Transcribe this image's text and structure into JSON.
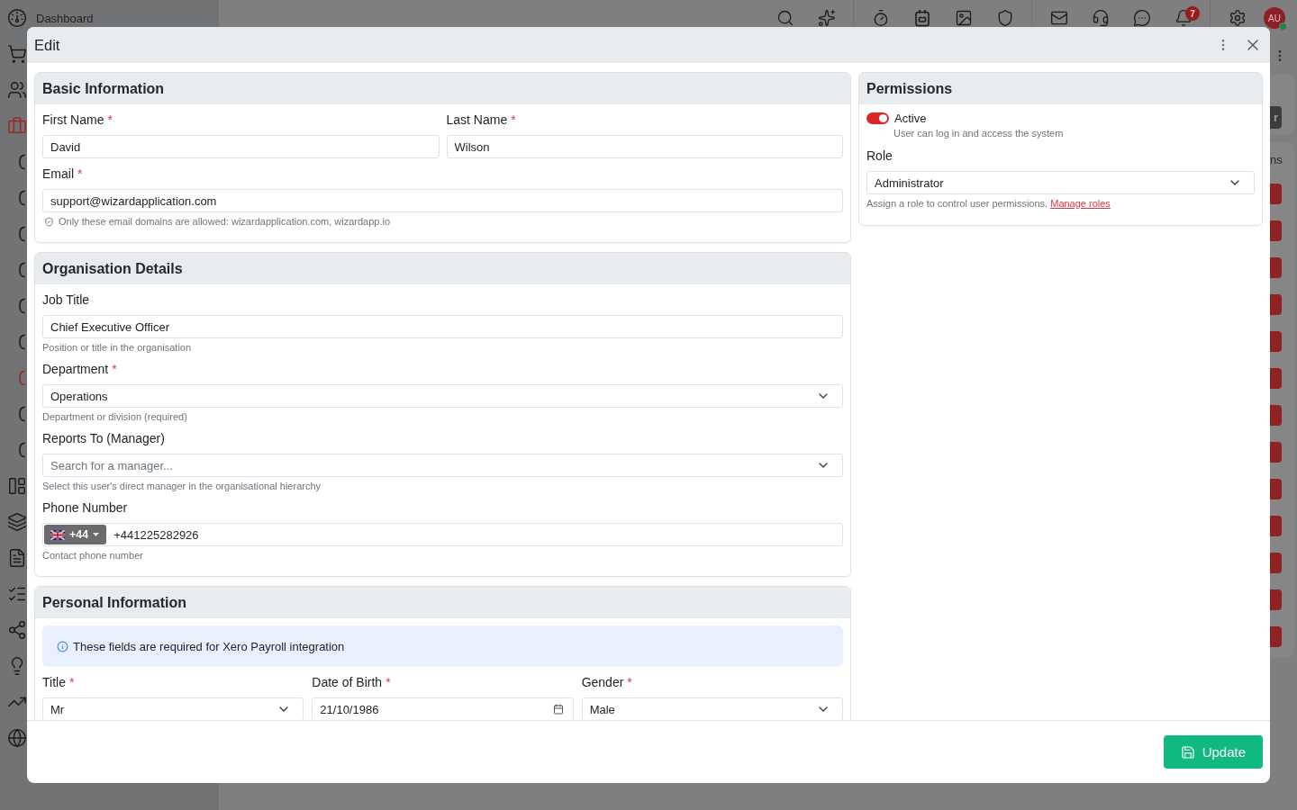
{
  "sidebar": {
    "items": [
      {
        "label": "Dashboard",
        "selected": false
      },
      {
        "selected": false
      },
      {
        "selected": false
      },
      {
        "selected": true,
        "children": [
          {
            "selected": false
          },
          {
            "selected": false
          },
          {
            "selected": false
          },
          {
            "selected": false
          },
          {
            "selected": false
          },
          {
            "selected": false
          },
          {
            "selected": true
          },
          {
            "selected": false
          },
          {
            "selected": false
          }
        ]
      },
      {
        "selected": false
      },
      {
        "selected": false
      },
      {
        "selected": false
      },
      {
        "selected": false
      },
      {
        "selected": false
      },
      {
        "selected": false
      },
      {
        "selected": false
      },
      {
        "selected": false
      }
    ]
  },
  "top_bar": {
    "notification_count": "7",
    "avatar": {
      "initials": "AU",
      "online": true
    }
  },
  "back_panel": {
    "button": "r",
    "heading": "ns"
  },
  "dialog": {
    "title": "Edit",
    "sections": [
      {
        "title": "Basic Information",
        "rows": [
          [
            {
              "kind": "text",
              "label": "First Name",
              "required_mark": "*",
              "value": "David"
            },
            {
              "kind": "text",
              "label": "Last Name",
              "required_mark": "*",
              "value": "Wilson"
            }
          ],
          [
            {
              "kind": "text",
              "label": "Email",
              "required_mark": "*",
              "value": "support@wizardapplication.com",
              "hint": "Only these email domains are allowed: wizardapplication.com, wizardapp.io",
              "hint_icon": true
            }
          ]
        ]
      },
      {
        "title": "Organisation Details",
        "rows": [
          [
            {
              "kind": "text",
              "label": "Job Title",
              "value": "Chief Executive Officer",
              "hint": "Position or title in the organisation"
            }
          ],
          [
            {
              "kind": "select",
              "label": "Department",
              "required_mark": "*",
              "value": "Operations",
              "hint": "Department or division (required)"
            }
          ],
          [
            {
              "kind": "select",
              "label": "Reports To (Manager)",
              "placeholder": "Search for a manager...",
              "hint": "Select this user's direct manager in the organisational hierarchy"
            }
          ],
          [
            {
              "kind": "phone",
              "label": "Phone Number",
              "country_code": "+44",
              "value": "+441225282926",
              "hint": "Contact phone number"
            }
          ]
        ]
      },
      {
        "title": "Personal Information",
        "rows": [
          [
            {
              "kind": "notice",
              "text": "These fields are required for Xero Payroll integration"
            }
          ],
          [
            {
              "kind": "select",
              "label": "Title",
              "required_mark": "*",
              "value": "Mr"
            },
            {
              "kind": "date",
              "label": "Date of Birth",
              "required_mark": "*",
              "value": "21/10/1986"
            },
            {
              "kind": "select",
              "label": "Gender",
              "required_mark": "*",
              "value": "Male"
            }
          ]
        ]
      }
    ],
    "permissions": {
      "title": "Permissions",
      "status": {
        "label": "Active",
        "description": "User can log in and access the system",
        "on": true
      },
      "role": {
        "label": "Role",
        "value": "Administrator",
        "hint": "Assign a role to control user permissions.",
        "link": "Manage roles"
      }
    },
    "footer": {
      "button": "Update"
    }
  }
}
